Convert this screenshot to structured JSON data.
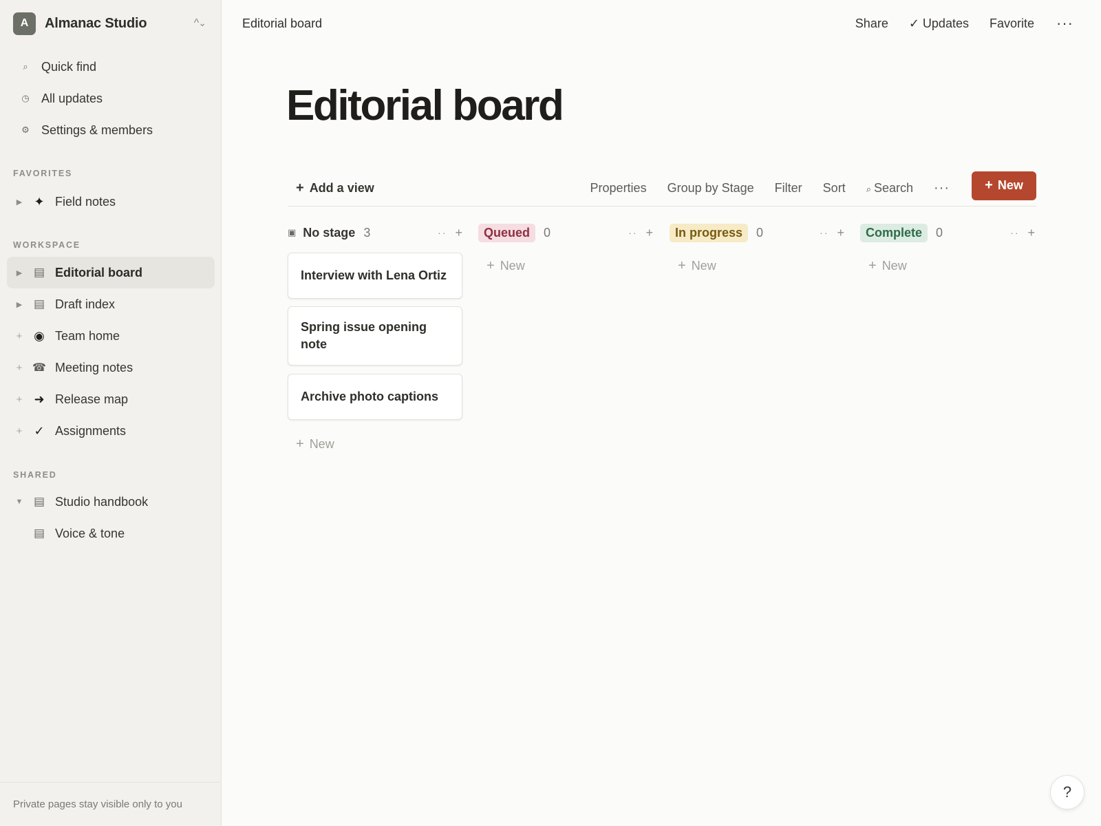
{
  "workspace": {
    "avatar_letter": "A",
    "name": "Almanac Studio",
    "switch_icon": "chevron-up-down-icon"
  },
  "sidebar": {
    "nav": [
      {
        "label": "Quick find",
        "icon": "search-icon",
        "glyph": "⌕"
      },
      {
        "label": "All updates",
        "icon": "clock-icon",
        "glyph": "◷"
      },
      {
        "label": "Settings & members",
        "icon": "gear-icon",
        "glyph": "⚙"
      }
    ],
    "favorites_label": "FAVORITES",
    "favorites": [
      {
        "label": "Field notes",
        "icon": "sparkle-icon",
        "glyph": "✦",
        "toggle": "▶"
      }
    ],
    "workspace_label": "WORKSPACE",
    "workspace_pages": [
      {
        "label": "Editorial board",
        "icon": "table-icon",
        "glyph": "▤",
        "toggle": "▶",
        "active": true
      },
      {
        "label": "Draft index",
        "icon": "table-icon",
        "glyph": "▤",
        "toggle": "▶"
      },
      {
        "label": "Team home",
        "icon": "target-icon",
        "glyph": "◉",
        "toggle": "+"
      },
      {
        "label": "Meeting notes",
        "icon": "phone-icon",
        "glyph": "☎",
        "toggle": "+"
      },
      {
        "label": "Release map",
        "icon": "arrow-right-icon",
        "glyph": "➜",
        "toggle": "+"
      },
      {
        "label": "Assignments",
        "icon": "check-icon",
        "glyph": "✓",
        "toggle": "+"
      }
    ],
    "shared_label": "SHARED",
    "shared_pages": [
      {
        "label": "Studio handbook",
        "icon": "table-icon",
        "glyph": "▤",
        "toggle": "▼"
      },
      {
        "label": "Voice & tone",
        "icon": "table-icon",
        "glyph": "▤",
        "toggle": ""
      }
    ],
    "footer_text": "Private pages stay visible only to you"
  },
  "topbar": {
    "breadcrumb": "Editorial board",
    "share": "Share",
    "updates": "✓ Updates",
    "favorite": "Favorite",
    "more": "···"
  },
  "page": {
    "title": "Editorial board"
  },
  "toolbar": {
    "add_view": "Add a view",
    "properties": "Properties",
    "group_by": "Group by Stage",
    "filter": "Filter",
    "sort": "Sort",
    "search": "Search",
    "more": "···",
    "new_label": "New",
    "new_color": "#b5472e"
  },
  "board": {
    "columns": [
      {
        "name": "No stage",
        "count": "3",
        "style": "plain",
        "cards": [
          "Interview with Lena Ortiz",
          "Spring issue opening note",
          "Archive photo captions"
        ],
        "new_label": "New"
      },
      {
        "name": "Queued",
        "count": "0",
        "style": "pill",
        "pill_bg": "#f5dde2",
        "pill_fg": "#8f2f42",
        "cards": [],
        "new_label": "New"
      },
      {
        "name": "In progress",
        "count": "0",
        "style": "pill",
        "pill_bg": "#f6ebc6",
        "pill_fg": "#7a5a12",
        "cards": [],
        "new_label": "New"
      },
      {
        "name": "Complete",
        "count": "0",
        "style": "pill",
        "pill_bg": "#dcece3",
        "pill_fg": "#2f6b48",
        "cards": [],
        "new_label": "New"
      }
    ]
  },
  "help": {
    "label": "?"
  }
}
